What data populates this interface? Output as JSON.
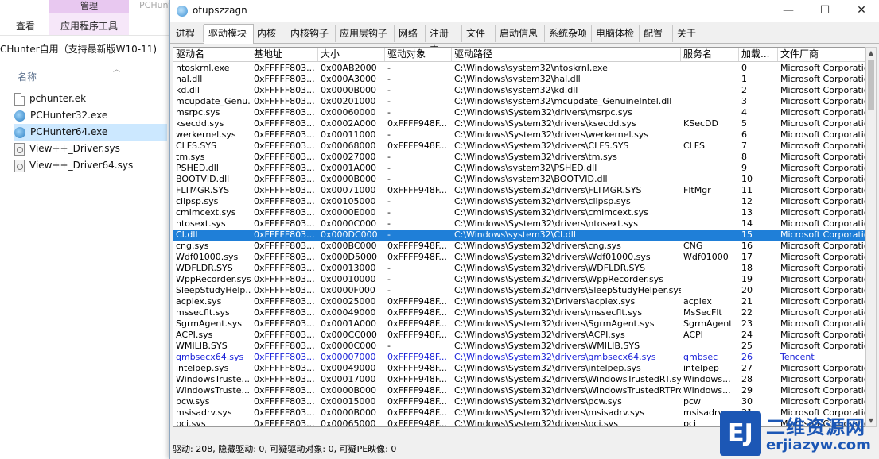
{
  "explorer": {
    "ghost_text": "PCHunt",
    "ribbon_tabs": [
      "查看",
      "应用程序工具"
    ],
    "context_tab": "管理",
    "address_text": "CHunter自用（支持最新版W10-11)",
    "column_name": "名称",
    "sort_icon": "chevron-up-icon",
    "files": [
      {
        "name": "pchunter.ek",
        "icon": "document-icon"
      },
      {
        "name": "PCHunter32.exe",
        "icon": "app-icon"
      },
      {
        "name": "PCHunter64.exe",
        "icon": "app-icon",
        "selected": true
      },
      {
        "name": "View++_Driver.sys",
        "icon": "system-file-icon"
      },
      {
        "name": "View++_Driver64.sys",
        "icon": "system-file-icon"
      }
    ]
  },
  "window": {
    "title": "otupszzagn",
    "controls": {
      "minimize": "—",
      "maximize": "☐",
      "close": "✕"
    },
    "tabs": [
      "进程",
      "驱动模块",
      "内核",
      "内核钩子",
      "应用层钩子",
      "网络",
      "注册表",
      "文件",
      "启动信息",
      "系统杂项",
      "电脑体检",
      "配置",
      "关于"
    ],
    "active_tab": 1,
    "columns": [
      "驱动名",
      "基地址",
      "大小",
      "驱动对象",
      "驱动路径",
      "服务名",
      "加载...",
      "文件厂商"
    ],
    "rows": [
      [
        "ntoskrnl.exe",
        "0xFFFFF803...",
        "0x00AB2000",
        "-",
        "C:\\Windows\\system32\\ntoskrnl.exe",
        "",
        "0",
        "Microsoft Corporation"
      ],
      [
        "hal.dll",
        "0xFFFFF803...",
        "0x000A3000",
        "-",
        "C:\\Windows\\system32\\hal.dll",
        "",
        "1",
        "Microsoft Corporation"
      ],
      [
        "kd.dll",
        "0xFFFFF803...",
        "0x0000B000",
        "-",
        "C:\\Windows\\system32\\kd.dll",
        "",
        "2",
        "Microsoft Corporation"
      ],
      [
        "mcupdate_Genu...",
        "0xFFFFF803...",
        "0x00201000",
        "-",
        "C:\\Windows\\system32\\mcupdate_GenuineIntel.dll",
        "",
        "3",
        "Microsoft Corporation"
      ],
      [
        "msrpc.sys",
        "0xFFFFF803...",
        "0x00060000",
        "-",
        "C:\\Windows\\System32\\drivers\\msrpc.sys",
        "",
        "4",
        "Microsoft Corporation"
      ],
      [
        "ksecdd.sys",
        "0xFFFFF803...",
        "0x0002A000",
        "0xFFFF948F...",
        "C:\\Windows\\System32\\drivers\\ksecdd.sys",
        "KSecDD",
        "5",
        "Microsoft Corporation"
      ],
      [
        "werkernel.sys",
        "0xFFFFF803...",
        "0x00011000",
        "-",
        "C:\\Windows\\System32\\drivers\\werkernel.sys",
        "",
        "6",
        "Microsoft Corporation"
      ],
      [
        "CLFS.SYS",
        "0xFFFFF803...",
        "0x00068000",
        "0xFFFF948F...",
        "C:\\Windows\\System32\\drivers\\CLFS.SYS",
        "CLFS",
        "7",
        "Microsoft Corporation"
      ],
      [
        "tm.sys",
        "0xFFFFF803...",
        "0x00027000",
        "-",
        "C:\\Windows\\System32\\drivers\\tm.sys",
        "",
        "8",
        "Microsoft Corporation"
      ],
      [
        "PSHED.dll",
        "0xFFFFF803...",
        "0x0001A000",
        "-",
        "C:\\Windows\\system32\\PSHED.dll",
        "",
        "9",
        "Microsoft Corporation"
      ],
      [
        "BOOTVID.dll",
        "0xFFFFF803...",
        "0x0000B000",
        "-",
        "C:\\Windows\\system32\\BOOTVID.dll",
        "",
        "10",
        "Microsoft Corporation"
      ],
      [
        "FLTMGR.SYS",
        "0xFFFFF803...",
        "0x00071000",
        "0xFFFF948F...",
        "C:\\Windows\\System32\\drivers\\FLTMGR.SYS",
        "FltMgr",
        "11",
        "Microsoft Corporation"
      ],
      [
        "clipsp.sys",
        "0xFFFFF803...",
        "0x00105000",
        "-",
        "C:\\Windows\\System32\\drivers\\clipsp.sys",
        "",
        "12",
        "Microsoft Corporation"
      ],
      [
        "cmimcext.sys",
        "0xFFFFF803...",
        "0x0000E000",
        "-",
        "C:\\Windows\\System32\\drivers\\cmimcext.sys",
        "",
        "13",
        "Microsoft Corporation"
      ],
      [
        "ntosext.sys",
        "0xFFFFF803...",
        "0x0000C000",
        "-",
        "C:\\Windows\\System32\\drivers\\ntosext.sys",
        "",
        "14",
        "Microsoft Corporation"
      ],
      [
        "CI.dll",
        "0xFFFFF803...",
        "0x000DC000",
        "-",
        "C:\\Windows\\system32\\CI.dll",
        "",
        "15",
        "Microsoft Corporation"
      ],
      [
        "cng.sys",
        "0xFFFFF803...",
        "0x000BC000",
        "0xFFFF948F...",
        "C:\\Windows\\System32\\drivers\\cng.sys",
        "CNG",
        "16",
        "Microsoft Corporation"
      ],
      [
        "Wdf01000.sys",
        "0xFFFFF803...",
        "0x000D5000",
        "0xFFFF948F...",
        "C:\\Windows\\System32\\drivers\\Wdf01000.sys",
        "Wdf01000",
        "17",
        "Microsoft Corporation"
      ],
      [
        "WDFLDR.SYS",
        "0xFFFFF803...",
        "0x00013000",
        "-",
        "C:\\Windows\\System32\\drivers\\WDFLDR.SYS",
        "",
        "18",
        "Microsoft Corporation"
      ],
      [
        "WppRecorder.sys",
        "0xFFFFF803...",
        "0x00010000",
        "-",
        "C:\\Windows\\System32\\drivers\\WppRecorder.sys",
        "",
        "19",
        "Microsoft Corporation"
      ],
      [
        "SleepStudyHelp...",
        "0xFFFFF803...",
        "0x0000F000",
        "-",
        "C:\\Windows\\System32\\drivers\\SleepStudyHelper.sys",
        "",
        "20",
        "Microsoft Corporation"
      ],
      [
        "acpiex.sys",
        "0xFFFFF803...",
        "0x00025000",
        "0xFFFF948F...",
        "C:\\Windows\\System32\\Drivers\\acpiex.sys",
        "acpiex",
        "21",
        "Microsoft Corporation"
      ],
      [
        "mssecflt.sys",
        "0xFFFFF803...",
        "0x00049000",
        "0xFFFF948F...",
        "C:\\Windows\\System32\\drivers\\mssecflt.sys",
        "MsSecFlt",
        "22",
        "Microsoft Corporation"
      ],
      [
        "SgrmAgent.sys",
        "0xFFFFF803...",
        "0x0001A000",
        "0xFFFF948F...",
        "C:\\Windows\\System32\\drivers\\SgrmAgent.sys",
        "SgrmAgent",
        "23",
        "Microsoft Corporation"
      ],
      [
        "ACPI.sys",
        "0xFFFFF803...",
        "0x000CC000",
        "0xFFFF948F...",
        "C:\\Windows\\System32\\drivers\\ACPI.sys",
        "ACPI",
        "24",
        "Microsoft Corporation"
      ],
      [
        "WMILIB.SYS",
        "0xFFFFF803...",
        "0x0000C000",
        "-",
        "C:\\Windows\\System32\\drivers\\WMILIB.SYS",
        "",
        "25",
        "Microsoft Corporation"
      ],
      [
        "qmbsecx64.sys",
        "0xFFFFF803...",
        "0x00007000",
        "0xFFFF948F...",
        "C:\\Windows\\System32\\drivers\\qmbsecx64.sys",
        "qmbsec",
        "26",
        "Tencent"
      ],
      [
        "intelpep.sys",
        "0xFFFFF803...",
        "0x00049000",
        "0xFFFF948F...",
        "C:\\Windows\\System32\\drivers\\intelpep.sys",
        "intelpep",
        "27",
        "Microsoft Corporation"
      ],
      [
        "WindowsTruste...",
        "0xFFFFF803...",
        "0x00017000",
        "0xFFFF948F...",
        "C:\\Windows\\System32\\drivers\\WindowsTrustedRT.sys",
        "Windows...",
        "28",
        "Microsoft Corporation"
      ],
      [
        "WindowsTruste...",
        "0xFFFFF803...",
        "0x0000B000",
        "0xFFFF948F...",
        "C:\\Windows\\System32\\drivers\\WindowsTrustedRTProx...",
        "Windows...",
        "29",
        "Microsoft Corporation"
      ],
      [
        "pcw.sys",
        "0xFFFFF803...",
        "0x00015000",
        "0xFFFF948F...",
        "C:\\Windows\\System32\\drivers\\pcw.sys",
        "pcw",
        "30",
        "Microsoft Corporation"
      ],
      [
        "msisadrv.sys",
        "0xFFFFF803...",
        "0x0000B000",
        "0xFFFF948F...",
        "C:\\Windows\\System32\\drivers\\msisadrv.sys",
        "msisadrv",
        "31",
        "Microsoft Corporation"
      ],
      [
        "pci.sys",
        "0xFFFFF803...",
        "0x00065000",
        "0xFFFF948F...",
        "C:\\Windows\\System32\\drivers\\pci.sys",
        "pci",
        "32",
        "Microsoft Corporation"
      ]
    ],
    "selected_row": 15,
    "highlight_row": 26,
    "status": "驱动: 208, 隐藏驱动: 0, 可疑驱动对象: 0, 可疑PE映像: 0"
  },
  "watermark": {
    "logo_text": "EJ",
    "title": "二维资源网",
    "url": "erjiazyw.com"
  },
  "colors": {
    "selection": "#1f7fd8",
    "tencent_highlight": "#1a22d8",
    "explorer_selection": "#cce8ff",
    "watermark": "#1c57b5"
  }
}
